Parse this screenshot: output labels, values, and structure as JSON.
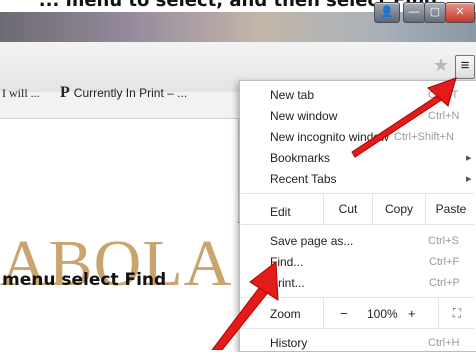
{
  "caption": {
    "top": "... menu to select, and then select Find",
    "bottom": "menu select Find"
  },
  "window_buttons": {
    "close_glyph": "✕",
    "max_glyph": "▢",
    "min_glyph": "—",
    "user_glyph": "👤"
  },
  "toolbar": {
    "star_glyph": "★",
    "menu_glyph": "≡"
  },
  "bookmarks": [
    {
      "label": "I will ..."
    },
    {
      "icon": "P",
      "label": "Currently In Print – ..."
    }
  ],
  "page_word": "ABOLA",
  "menu": {
    "new_tab": {
      "label": "New tab",
      "shortcut": "Ctrl+T"
    },
    "new_window": {
      "label": "New window",
      "shortcut": "Ctrl+N"
    },
    "incognito": {
      "label": "New incognito window",
      "shortcut": "Ctrl+Shift+N"
    },
    "bookmarks": {
      "label": "Bookmarks",
      "submenu_glyph": "▸"
    },
    "recent_tabs": {
      "label": "Recent Tabs",
      "submenu_glyph": "▸"
    },
    "edit": {
      "label": "Edit",
      "cut": "Cut",
      "copy": "Copy",
      "paste": "Paste"
    },
    "save_page": {
      "label": "Save page as...",
      "shortcut": "Ctrl+S"
    },
    "find": {
      "label": "Find...",
      "shortcut": "Ctrl+F"
    },
    "print": {
      "label": "Print...",
      "shortcut": "Ctrl+P"
    },
    "zoom": {
      "label": "Zoom",
      "minus": "−",
      "value": "100%",
      "plus": "+",
      "fullscreen": "⛶"
    },
    "history": {
      "label": "History",
      "shortcut": "Ctrl+H"
    }
  },
  "colors": {
    "arrow": "#e31b1b",
    "accent_text": "#cba36d"
  }
}
